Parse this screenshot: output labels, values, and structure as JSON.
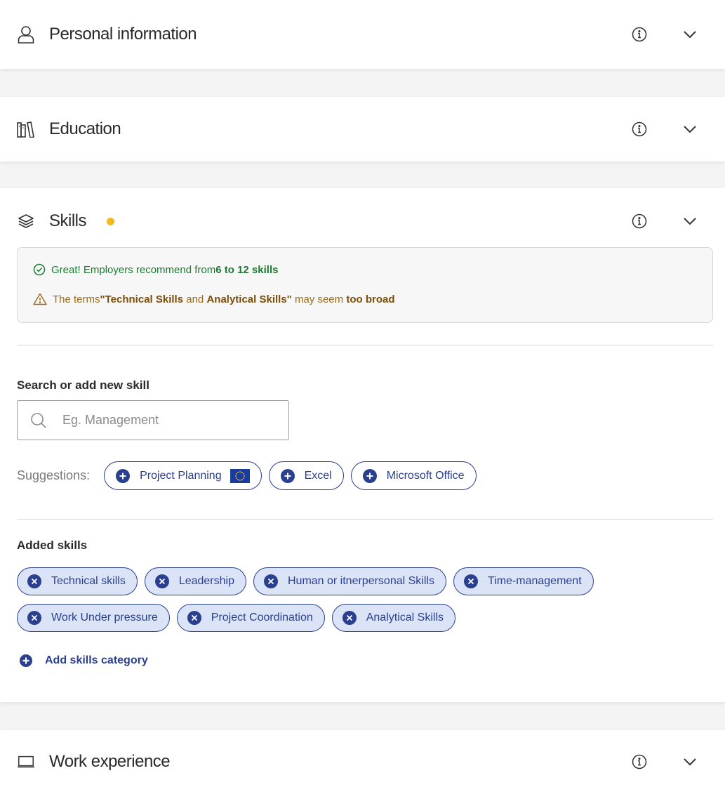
{
  "sections": {
    "personal": {
      "title": "Personal information",
      "icon": "person-icon"
    },
    "education": {
      "title": "Education",
      "icon": "books-icon"
    },
    "skills": {
      "title": "Skills",
      "icon": "layers-icon",
      "status_color": "#f1b81f"
    },
    "work": {
      "title": "Work experience",
      "icon": "laptop-icon"
    }
  },
  "feedback": {
    "success_prefix": "Great! Employers recommend from ",
    "success_bold": "6 to 12 skills",
    "warning_prefix": "The terms ",
    "warning_bold1": "\"Technical Skills",
    "warning_mid": " and ",
    "warning_bold2": "Analytical Skills\"",
    "warning_mid2": " may seem ",
    "warning_bold3": "too broad",
    "success_color": "#1c7a32",
    "warning_color": "#9a6a1a"
  },
  "search": {
    "label": "Search or add new skill",
    "placeholder": "Eg. Management"
  },
  "suggestions": {
    "label": "Suggestions:",
    "items": [
      "Project Planning",
      "Excel",
      "Microsoft Office"
    ]
  },
  "added": {
    "label": "Added skills",
    "row1": [
      "Technical skills",
      "Leadership",
      "Human or itnerpersonal Skills",
      "Time-management"
    ],
    "row2": [
      "Work Under pressure",
      "Project Coordination",
      "Analytical Skills"
    ]
  },
  "add_category": "Add skills category",
  "colors": {
    "accent": "#2b3f8f",
    "tag_bg": "#dbe4f7"
  }
}
